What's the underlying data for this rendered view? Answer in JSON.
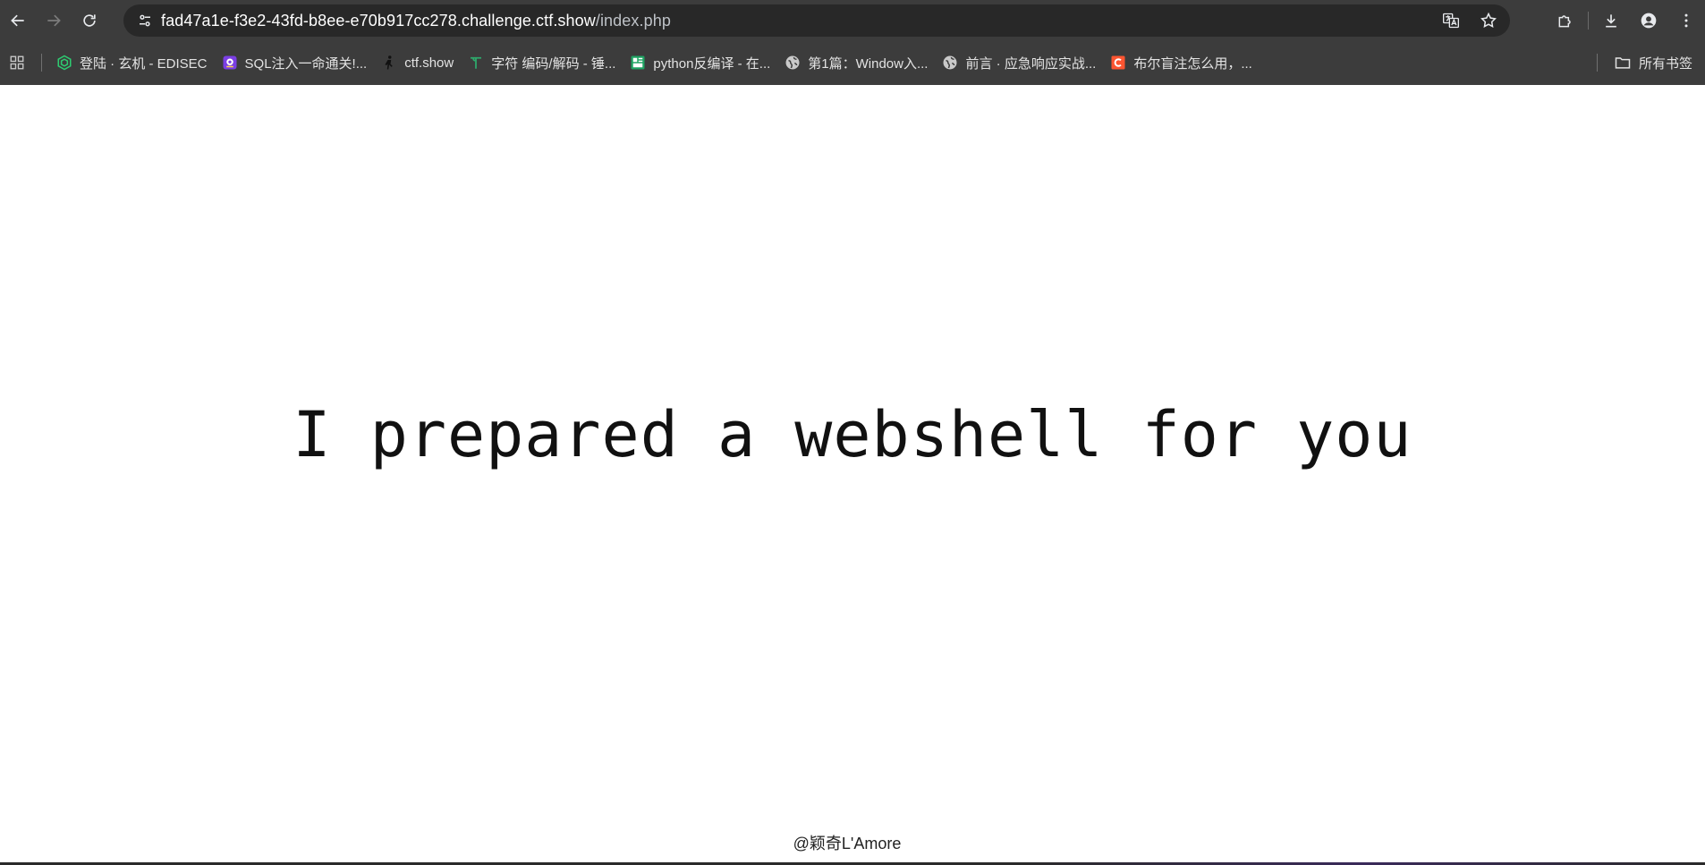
{
  "browser": {
    "url_host": "fad47a1e-f3e2-43fd-b8ee-e70b917cc278.challenge.ctf.show",
    "url_path": "/index.php",
    "bookmarks": [
      {
        "label": "登陆 · 玄机 - EDISEC",
        "icon": "hexagon-icon",
        "color": "#2ecc71"
      },
      {
        "label": "SQL注入一命通关!...",
        "icon": "purple-app-icon",
        "color": "#7b3fe4"
      },
      {
        "label": "ctf.show",
        "icon": "runner-icon",
        "color": "#111111"
      },
      {
        "label": "字符 编码/解码 - 锤...",
        "icon": "t-tool-icon",
        "color": "#2ea86b"
      },
      {
        "label": "python反编译 - 在...",
        "icon": "tool-site-icon",
        "color": "#1fa463"
      },
      {
        "label": "第1篇：Window入...",
        "icon": "globe-icon",
        "color": "#c9c9c9"
      },
      {
        "label": "前言 · 应急响应实战...",
        "icon": "globe-icon",
        "color": "#c9c9c9"
      },
      {
        "label": "布尔盲注怎么用，...",
        "icon": "c-site-icon",
        "color": "#fc5531"
      }
    ],
    "all_bookmarks_label": "所有书签"
  },
  "page": {
    "headline": "I prepared a webshell for you",
    "credit": "@颖奇L'Amore"
  }
}
